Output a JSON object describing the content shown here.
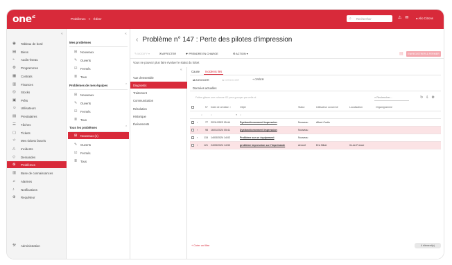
{
  "topbar": {
    "logo": "one",
    "breadcrumb": [
      "Problèmes",
      ">",
      "Éditer"
    ],
    "search_placeholder": "Rechercher",
    "user_name": "Alio Citrons",
    "accent": "#d82a3a"
  },
  "leftnav": {
    "items": [
      {
        "label": "Tableau de bord",
        "icon": "dashboard-icon"
      },
      {
        "label": "Biens",
        "icon": "box-icon"
      },
      {
        "label": "Audit réseau",
        "icon": "audit-icon"
      },
      {
        "label": "Programmes",
        "icon": "programs-icon"
      },
      {
        "label": "Contrats",
        "icon": "contract-icon"
      },
      {
        "label": "Finances",
        "icon": "finance-icon"
      },
      {
        "label": "Stocks",
        "icon": "stock-icon"
      },
      {
        "label": "Prêts",
        "icon": "loan-icon"
      },
      {
        "label": "Utilisateurs",
        "icon": "users-icon"
      },
      {
        "label": "Prestataires",
        "icon": "supplier-icon"
      },
      {
        "label": "Tâches",
        "icon": "tasks-icon"
      },
      {
        "label": "Tickets",
        "icon": "ticket-icon"
      },
      {
        "label": "Mes tickets favoris",
        "icon": "star-icon"
      },
      {
        "label": "Incidents",
        "icon": "warning-icon"
      },
      {
        "label": "Demandes",
        "icon": "request-icon"
      },
      {
        "label": "Problèmes",
        "icon": "problem-icon",
        "active": true
      },
      {
        "label": "Base de connaissances",
        "icon": "book-icon"
      },
      {
        "label": "Alarmes",
        "icon": "bell-icon"
      },
      {
        "label": "Notifications",
        "icon": "notification-icon"
      },
      {
        "label": "Requêteur",
        "icon": "query-icon"
      }
    ],
    "admin": "Administration"
  },
  "subnav": {
    "groups": [
      {
        "title": "Mes problèmes",
        "items": [
          "Nouveaux",
          "Ouverts",
          "Fermés",
          "Tous"
        ]
      },
      {
        "title": "Problèmes de mes équipes",
        "items": [
          "Nouveaux",
          "Ouverts",
          "Fermés",
          "Tous"
        ]
      },
      {
        "title": "Tous les problèmes",
        "items": [
          "Nouveaux (1)",
          "Ouverts",
          "Fermés",
          "Tous"
        ]
      }
    ]
  },
  "main": {
    "title": "Problème n° 147 : Perte des pilotes d'impression",
    "toolbar": {
      "modify": "MODIFY",
      "affect": "AFFECTER",
      "take": "PRENDRE EN CHARGE",
      "action": "ACTION",
      "pink_button": "ENREGISTRER & FERMER"
    },
    "note": "Vous ne pouvez plus faire évoluer le statut du ticket",
    "ticket_menu": [
      "Vue d'ensemble",
      "Diagnostic",
      "Traitement",
      "Communication",
      "Résolution",
      "Historique",
      "Événements"
    ],
    "tabs": [
      "Cause",
      "Incidents liés"
    ],
    "actions": {
      "associate": "ASSOCIER",
      "dissociate": "DISSOCIER",
      "create": "CRÉER"
    },
    "subtab": "Données actuelles",
    "filter_hint": "Faites glisser une colonne ICI pour grouper par celle-ci",
    "search_placeholder": "Rechercher...",
    "columns": [
      "",
      "",
      "N°",
      "Date de création",
      "Objet",
      "Statut",
      "Utilisateur concerné",
      "Localisation",
      "Organigramme"
    ],
    "rows": [
      {
        "num": "77",
        "date": "22/11/2023 15:44",
        "subject": "Dysfonctionnement Impression",
        "status": "Nouveau",
        "user": "Albert Curtis",
        "location": "",
        "org": "",
        "pink": false
      },
      {
        "num": "98",
        "date": "16/01/2024 05:41",
        "subject": "Dysfonctionnement Impression",
        "status": "Nouveau",
        "user": "",
        "location": "",
        "org": "",
        "pink": true
      },
      {
        "num": "115",
        "date": "14/03/2024 14:02",
        "subject": "Problème sur un équipement",
        "status": "Nouveau",
        "user": "",
        "location": "",
        "org": "",
        "pink": false
      },
      {
        "num": "121",
        "date": "24/05/2024 14:50",
        "subject": "problème impression sur l'imprimante",
        "status": "Annulé",
        "user": "Eric Bibal",
        "location": "Ile-de-France",
        "org": "",
        "pink": true
      }
    ],
    "create_filter": "+ Créer un filtre",
    "pager": "4 élément(s)"
  }
}
